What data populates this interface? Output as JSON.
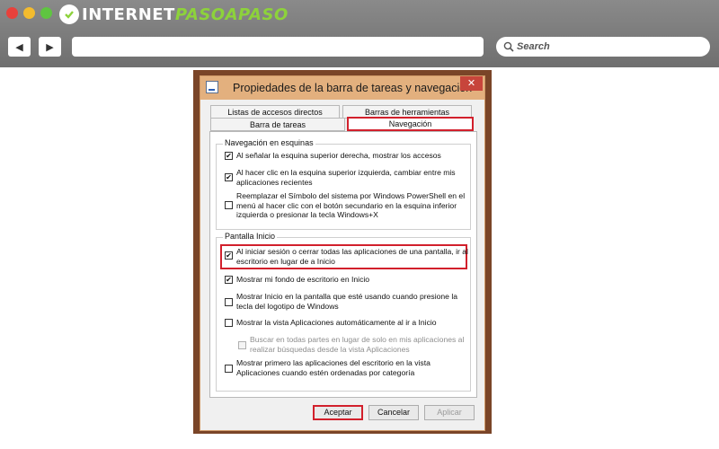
{
  "browser": {
    "logo_part1": "INTERNET",
    "logo_part2": "PASOAPASO",
    "back_icon": "back-arrow-icon",
    "forward_icon": "forward-arrow-icon",
    "search_placeholder": "Search"
  },
  "dialog": {
    "title": "Propiedades de la barra de tareas y navegación",
    "close_label": "✕",
    "tabs_row1": [
      "Listas de accesos directos",
      "Barras de herramientas"
    ],
    "tabs_row2": [
      "Barra de tareas",
      "Navegación"
    ],
    "active_tab": "Navegación",
    "group1": {
      "label": "Navegación en esquinas",
      "options": [
        {
          "label": "Al señalar la esquina superior derecha, mostrar los accesos",
          "checked": true
        },
        {
          "label": "Al hacer clic en la esquina superior izquierda, cambiar entre mis\naplicaciones recientes",
          "checked": true
        },
        {
          "label": "Reemplazar el Símbolo del sistema por Windows PowerShell en el\nmenú al hacer clic con el botón secundario en la esquina inferior\nizquierda o presionar la tecla Windows+X",
          "checked": false
        }
      ]
    },
    "group2": {
      "label": "Pantalla Inicio",
      "options": [
        {
          "label": "Al iniciar sesión o cerrar todas las aplicaciones de una pantalla, ir al\nescritorio en lugar de a Inicio",
          "checked": true
        },
        {
          "label": "Mostrar mi fondo de escritorio en Inicio",
          "checked": true
        },
        {
          "label": "Mostrar Inicio en la pantalla que esté usando cuando presione la\ntecla del logotipo de Windows",
          "checked": false
        },
        {
          "label": "Mostrar la vista Aplicaciones automáticamente al ir a Inicio",
          "checked": false
        },
        {
          "label": "Buscar en todas partes en lugar de solo en mis aplicaciones al\nrealizar búsquedas desde la vista Aplicaciones",
          "checked": false,
          "disabled": true
        },
        {
          "label": "Mostrar primero las aplicaciones del escritorio en la vista\nAplicaciones cuando estén ordenadas por categoría",
          "checked": false
        }
      ]
    },
    "buttons": {
      "accept": "Aceptar",
      "cancel": "Cancelar",
      "apply": "Aplicar"
    },
    "check_mark": "✔"
  },
  "colors": {
    "highlight": "#d2202c",
    "brand_green": "#8dd23b",
    "titlebar": "#e3b07e",
    "frame": "#7a4528"
  }
}
